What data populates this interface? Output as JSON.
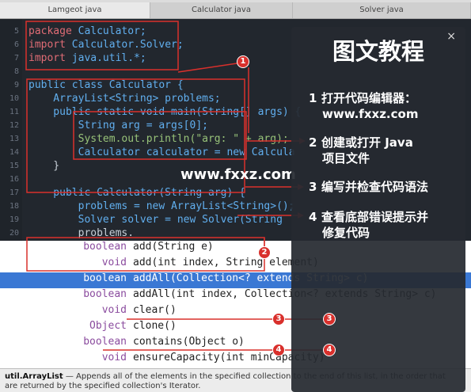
{
  "tabs": [
    {
      "label": "Lamgeot java"
    },
    {
      "label": "Calculator java"
    },
    {
      "label": "Solver java"
    }
  ],
  "editor": {
    "line_numbers": [
      "5",
      "6",
      "7",
      "8",
      "9",
      "10",
      "11",
      "12",
      "13",
      "14",
      "15",
      "16",
      "17",
      "18",
      "19",
      "20"
    ],
    "lines": {
      "l5_kw": "package",
      "l5_rest": " Calculator;",
      "l6_kw": "import",
      "l6_rest": " Calculator.Solver;",
      "l7_kw": "import",
      "l7_rest": " java.util.*;",
      "l9": "public class Calculator {",
      "l10": "    ArrayList<String> problems;",
      "l11": "    public static void main(String[] args) {",
      "l12": "        String arg = args[0];",
      "l13": "        System.out.println(\"arg: \" + arg);",
      "l14": "        Calculator calculator = new Calcula",
      "l15": "    }",
      "l17": "    public Calculator(String arg) {",
      "l18": "        problems = new ArrayList<String>();",
      "l19": "        Solver solver = new Solver(String",
      "l20": "        problems."
    }
  },
  "autocomplete": {
    "items": [
      {
        "type": "boolean",
        "sig": "add(String e)"
      },
      {
        "type": "void",
        "sig": "add(int index, String element)"
      },
      {
        "type": "boolean",
        "sig": "addAll(Collection<? extends String> c)",
        "selected": true
      },
      {
        "type": "boolean",
        "sig": "addAll(int index, Collection<? extends String> c)"
      },
      {
        "type": "void",
        "sig": "clear()"
      },
      {
        "type": "Object",
        "sig": "clone()"
      },
      {
        "type": "boolean",
        "sig": "contains(Object o)"
      },
      {
        "type": "void",
        "sig": "ensureCapacity(int minCapacity)"
      }
    ]
  },
  "doc": {
    "title": "util.ArrayList",
    "text": " — Appends all of the elements in the specified collection to the end of this list, in the order that",
    "text2": "are returned by the specified collection's Iterator."
  },
  "panel": {
    "title": "图文教程",
    "close": "×",
    "steps": [
      {
        "num": "1",
        "text": "打开代码编辑器：",
        "sub": "www.fxxz.com"
      },
      {
        "num": "2",
        "text": "创建或打开 Java",
        "sub": "项目文件"
      },
      {
        "num": "3",
        "text": "编写并检查代码语法",
        "sub": ""
      },
      {
        "num": "4",
        "text": "查看底部错误提示并",
        "sub": "修复代码"
      }
    ]
  },
  "watermark": "www.fxxz.com",
  "badges": [
    "1",
    "2",
    "3",
    "3",
    "4",
    "4"
  ],
  "colors": {
    "annotation": "#d9302c",
    "editor_bg": "#22272e",
    "selection": "#3a78d4"
  }
}
